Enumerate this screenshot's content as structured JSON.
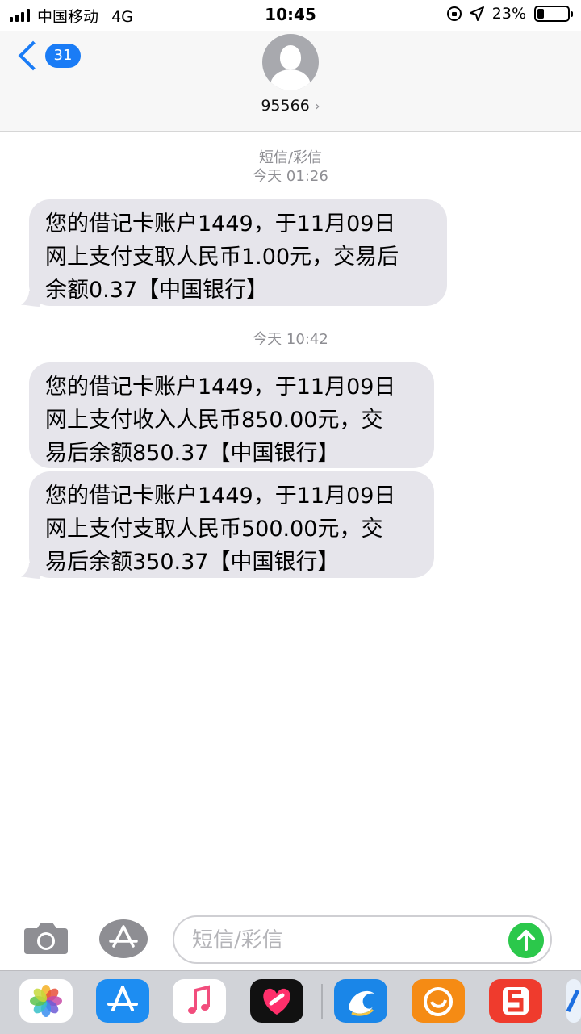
{
  "status_bar": {
    "carrier": "中国移动",
    "network": "4G",
    "time": "10:45",
    "battery_text": "23%",
    "battery_level": 0.23
  },
  "header": {
    "back_badge": "31",
    "contact": "95566"
  },
  "thread": [
    {
      "service": "短信/彩信",
      "timestamp": "今天 01:26"
    },
    {
      "timestamp": "今天 10:42"
    }
  ],
  "messages": [
    {
      "lines": [
        "您的借记卡账户1449，于11月09日",
        "网上支付支取人民币1.00元，交易后",
        "余额0.37【中国银行】"
      ]
    },
    {
      "lines": [
        "您的借记卡账户1449，于11月09日",
        "网上支付收入人民币850.00元，交",
        "易后余额850.37【中国银行】"
      ]
    },
    {
      "lines": [
        "您的借记卡账户1449，于11月09日",
        "网上支付支取人民币500.00元，交",
        "易后余额350.37【中国银行】"
      ]
    }
  ],
  "input": {
    "placeholder": "短信/彩信"
  },
  "colors": {
    "accent": "#1a7cf6",
    "bubble": "#e6e5eb",
    "send": "#2bc84b",
    "timestamp": "#8e8e93"
  },
  "dock_apps": [
    "photos-app-icon",
    "app-store-app-icon",
    "music-app-icon",
    "heart-app-icon",
    "dolphin-app-icon",
    "uc-browser-app-icon",
    "sogou-app-icon",
    "partial-app-icon"
  ]
}
